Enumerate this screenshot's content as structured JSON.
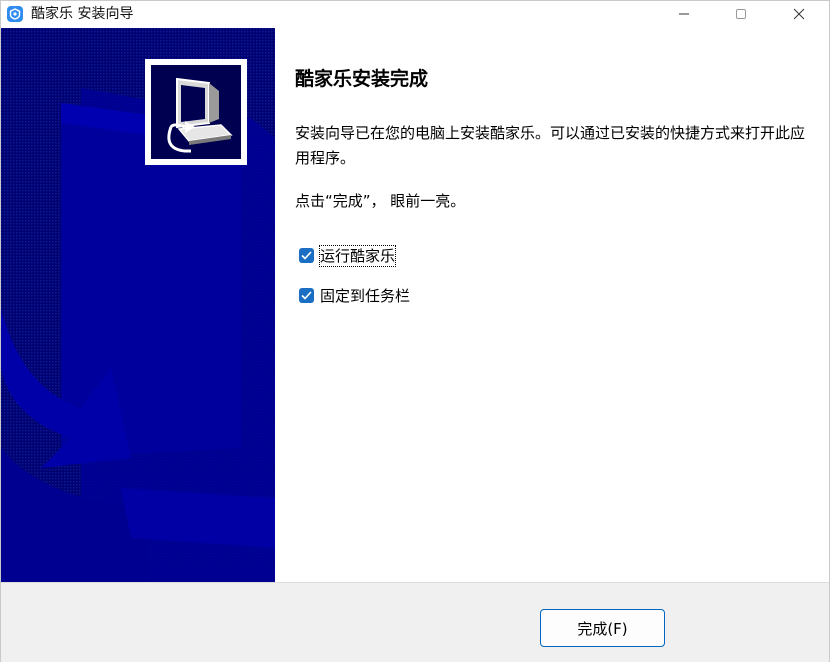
{
  "window": {
    "title": "酷家乐 安装向导",
    "accent_color": "#0067c0",
    "banner_color": "#000080"
  },
  "content": {
    "heading": "酷家乐安装完成",
    "description": "安装向导已在您的电脑上安装酷家乐。可以通过已安装的快捷方式来打开此应用程序。",
    "hint": "点击“完成”， 眼前一亮。",
    "options": [
      {
        "label": "运行酷家乐",
        "checked": true
      },
      {
        "label": "固定到任务栏",
        "checked": true
      }
    ]
  },
  "footer": {
    "finish_label": "完成(F)"
  },
  "icons": {
    "app": "app-shield-icon",
    "minimize": "minimize-icon",
    "maximize": "maximize-icon",
    "close": "close-icon",
    "installer": "installer-computer-icon"
  }
}
